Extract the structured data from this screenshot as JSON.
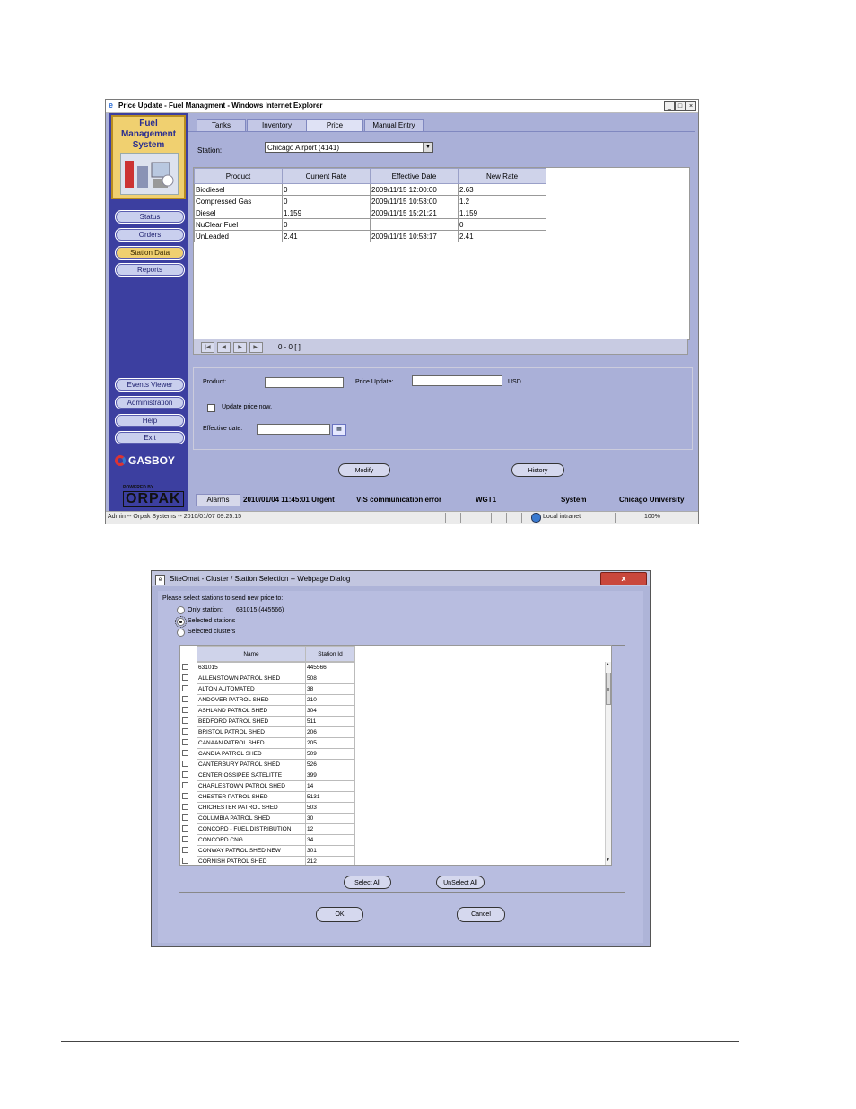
{
  "window1": {
    "title": "Price Update - Fuel Managment - Windows Internet Explorer",
    "controls": [
      "_",
      "□",
      "×"
    ],
    "logo_title": [
      "Fuel",
      "Management",
      "System"
    ],
    "nav": [
      "Status",
      "Orders",
      "Station Data",
      "Reports"
    ],
    "nav_bottom": [
      "Events Viewer",
      "Administration",
      "Help",
      "Exit"
    ],
    "brand": "GASBOY",
    "powered_by": "POWERED BY",
    "powered_logo": "ORPAK",
    "tabs": [
      "Tanks",
      "Inventory",
      "Price",
      "Manual Entry"
    ],
    "active_tab": "Price",
    "station_label": "Station:",
    "station_value": "Chicago Airport (4141)",
    "columns": [
      "Product",
      "Current Rate",
      "Effective Date",
      "New Rate"
    ],
    "rows": [
      [
        "Biodiesel",
        "0",
        "2009/11/15 12:00:00",
        "2.63"
      ],
      [
        "Compressed Gas",
        "0",
        "2009/11/15 10:53:00",
        "1.2"
      ],
      [
        "Diesel",
        "1.159",
        "2009/11/15 15:21:21",
        "1.159"
      ],
      [
        "NuClear Fuel",
        "0",
        "",
        "0"
      ],
      [
        "UnLeaded",
        "2.41",
        "2009/11/15 10:53:17",
        "2.41"
      ]
    ],
    "pager_text": "0 - 0  [ ]",
    "form": {
      "product_label": "Product:",
      "price_update_label": "Price Update:",
      "currency": "USD",
      "update_now_label": "Update price now.",
      "effective_date_label": "Effective date:",
      "calendar_glyph": "▦"
    },
    "modify_label": "Modify",
    "history_label": "History",
    "alarm": {
      "button": "Alarms",
      "datetime": "2010/01/04 11:45:01 Urgent",
      "message": "VIS communication error",
      "code": "WGT1",
      "source": "System",
      "site": "Chicago University"
    },
    "status": {
      "user": "Admin -- Orpak Systems -- 2010/01/07  09:25:15",
      "zone": "Local intranet",
      "zoom": "100%"
    }
  },
  "window2": {
    "title": "SiteOmat - Cluster / Station Selection -- Webpage Dialog",
    "close": "x",
    "prompt": "Please select stations to send new price to:",
    "options": [
      {
        "label": "Only station:",
        "extra": "631015 (445566)"
      },
      {
        "label": "Selected stations",
        "extra": ""
      },
      {
        "label": "Selected clusters",
        "extra": ""
      }
    ],
    "columns": [
      "Name",
      "Station Id"
    ],
    "rows": [
      [
        "631015",
        "445566"
      ],
      [
        "ALLENSTOWN PATROL SHED",
        "508"
      ],
      [
        "ALTON AUTOMATED",
        "38"
      ],
      [
        "ANDOVER PATROL SHED",
        "210"
      ],
      [
        "ASHLAND PATROL SHED",
        "304"
      ],
      [
        "BEDFORD PATROL SHED",
        "511"
      ],
      [
        "BRISTOL PATROL SHED",
        "206"
      ],
      [
        "CANAAN PATROL SHED",
        "205"
      ],
      [
        "CANDIA PATROL SHED",
        "509"
      ],
      [
        "CANTERBURY PATROL SHED",
        "526"
      ],
      [
        "CENTER OSSIPEE SATELITTE",
        "399"
      ],
      [
        "CHARLESTOWN PATROL SHED",
        "14"
      ],
      [
        "CHESTER PATROL SHED",
        "5131"
      ],
      [
        "CHICHESTER PATROL SHED",
        "503"
      ],
      [
        "COLUMBIA PATROL SHED",
        "30"
      ],
      [
        "CONCORD - FUEL DISTRIBUTION",
        "12"
      ],
      [
        "CONCORD CNG",
        "34"
      ],
      [
        "CONWAY PATROL SHED NEW",
        "301"
      ],
      [
        "CORNISH PATROL SHED",
        "212"
      ]
    ],
    "select_all": "Select All",
    "unselect_all": "UnSelect All",
    "ok": "OK",
    "cancel": "Cancel"
  }
}
